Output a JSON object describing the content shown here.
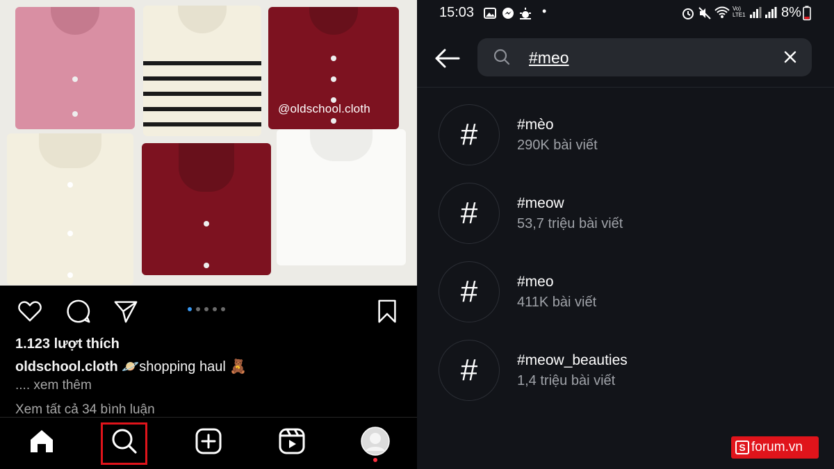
{
  "left_panel": {
    "photo_watermark": "@oldschool.cloth",
    "carousel": {
      "total": 5,
      "active_index": 0
    },
    "likes": "1.123 lượt thích",
    "caption": {
      "username": "oldschool.cloth",
      "text": "🪐shopping haul 🧸"
    },
    "more_label": ".... xem thêm",
    "comments_label": "Xem tất cả 34 bình luận",
    "icons": {
      "like": "heart-icon",
      "comment": "comment-bubble-icon",
      "share": "paper-plane-icon",
      "save": "bookmark-icon"
    },
    "bottom_nav": [
      {
        "name": "home",
        "icon": "home-icon"
      },
      {
        "name": "search",
        "icon": "search-icon",
        "highlighted": true
      },
      {
        "name": "create",
        "icon": "plus-square-icon"
      },
      {
        "name": "reels",
        "icon": "reels-icon"
      },
      {
        "name": "profile",
        "icon": "avatar-icon"
      }
    ],
    "highlight_color": "#e0141b"
  },
  "right_panel": {
    "status_bar": {
      "time": "15:03",
      "battery": "8%",
      "network_label": "Vo) LTE1"
    },
    "search": {
      "query": "#meo"
    },
    "results": [
      {
        "tag": "#mèo",
        "count": "290K bài viết"
      },
      {
        "tag": "#meow",
        "count": "53,7 triệu bài viết"
      },
      {
        "tag": "#meo",
        "count": "411K bài viết"
      },
      {
        "tag": "#meow_beauties",
        "count": "1,4 triệu bài viết"
      }
    ],
    "result_icon_glyph": "#"
  },
  "watermark_badge": {
    "logo_letter": "S",
    "text": "forum.vn",
    "color": "#e0141b"
  }
}
